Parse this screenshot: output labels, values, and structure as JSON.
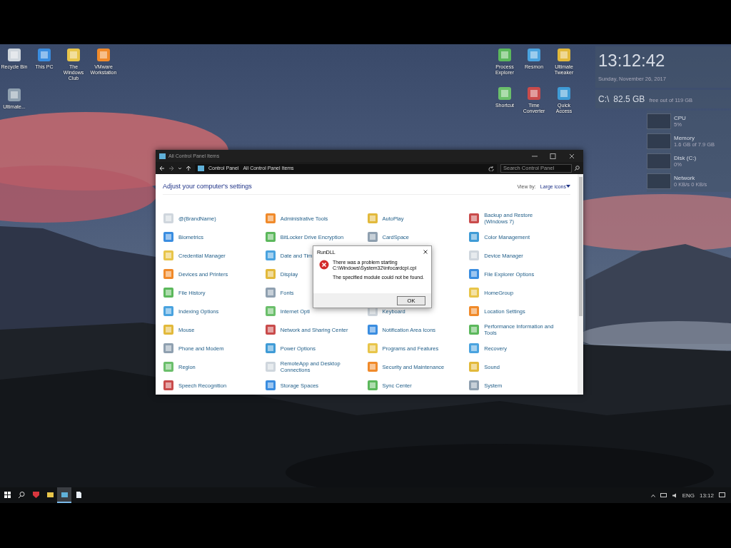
{
  "desktop_icons": [
    {
      "label": "Recycle Bin"
    },
    {
      "label": "This PC"
    },
    {
      "label": "The Windows Club"
    },
    {
      "label": "VMware Workstation"
    },
    {
      "label": "Process Explorer"
    },
    {
      "label": "Resmon"
    },
    {
      "label": "Ultimate Tweaker"
    },
    {
      "label": "Ultimate..."
    },
    {
      "label": "Shortcut"
    },
    {
      "label": "Time Converter"
    },
    {
      "label": "Quick Access"
    }
  ],
  "widgets": {
    "clock": {
      "time": "13:12:42",
      "date": "Sunday, November 26, 2017"
    },
    "disk": {
      "drive": "C:\\",
      "free": "82.5 GB",
      "detail": "free out of 119 GB"
    },
    "meters": [
      {
        "name": "CPU",
        "value": "5%"
      },
      {
        "name": "Memory",
        "value": "1.6 GB of 7.9 GB"
      },
      {
        "name": "Disk (C:)",
        "value": "0%"
      },
      {
        "name": "Network",
        "value": "0 KB/s 0 KB/s"
      }
    ]
  },
  "window": {
    "title": "All Control Panel Items",
    "breadcrumbs": [
      "Control Panel",
      "All Control Panel Items"
    ],
    "search": {
      "placeholder": "Search Control Panel"
    },
    "heading": "Adjust your computer's settings",
    "view_by": {
      "label": "View by:",
      "value": "Large icons"
    },
    "items": [
      {
        "kind": "item",
        "label": "@(BrandName)"
      },
      {
        "kind": "item",
        "label": "Administrative Tools"
      },
      {
        "kind": "item",
        "label": "AutoPlay"
      },
      {
        "kind": "item",
        "label": "Backup and Restore (Windows 7)"
      },
      {
        "kind": "item",
        "label": "Biometrics"
      },
      {
        "kind": "item",
        "label": "BitLocker Drive Encryption"
      },
      {
        "kind": "item",
        "label": "CardSpace"
      },
      {
        "kind": "item",
        "label": "Color Management"
      },
      {
        "kind": "item",
        "label": "Credential Manager"
      },
      {
        "kind": "item",
        "label": "Date and Tim"
      },
      {
        "kind": "covered"
      },
      {
        "kind": "item",
        "label": "Device Manager"
      },
      {
        "kind": "item",
        "label": "Devices and Printers"
      },
      {
        "kind": "item",
        "label": "Display"
      },
      {
        "kind": "covered"
      },
      {
        "kind": "item",
        "label": "File Explorer Options"
      },
      {
        "kind": "item",
        "label": "File History"
      },
      {
        "kind": "item",
        "label": "Fonts"
      },
      {
        "kind": "covered"
      },
      {
        "kind": "item",
        "label": "HomeGroup"
      },
      {
        "kind": "item",
        "label": "Indexing Options"
      },
      {
        "kind": "item",
        "label": "Internet Opti"
      },
      {
        "kind": "item",
        "label": "Keyboard"
      },
      {
        "kind": "item",
        "label": "Location Settings"
      },
      {
        "kind": "item",
        "label": "Mouse"
      },
      {
        "kind": "item",
        "label": "Network and Sharing Center"
      },
      {
        "kind": "item",
        "label": "Notification Area Icons"
      },
      {
        "kind": "item",
        "label": "Performance Information and Tools"
      },
      {
        "kind": "item",
        "label": "Phone and Modem"
      },
      {
        "kind": "item",
        "label": "Power Options"
      },
      {
        "kind": "item",
        "label": "Programs and Features"
      },
      {
        "kind": "item",
        "label": "Recovery"
      },
      {
        "kind": "item",
        "label": "Region"
      },
      {
        "kind": "item",
        "label": "RemoteApp and Desktop Connections"
      },
      {
        "kind": "item",
        "label": "Security and Maintenance"
      },
      {
        "kind": "item",
        "label": "Sound"
      },
      {
        "kind": "item",
        "label": "Speech Recognition"
      },
      {
        "kind": "item",
        "label": "Storage Spaces"
      },
      {
        "kind": "item",
        "label": "Sync Center"
      },
      {
        "kind": "item",
        "label": "System"
      }
    ]
  },
  "dialog": {
    "title": "RunDLL",
    "message": "There was a problem starting",
    "path": "C:\\Windows\\System32\\infocardcpl.cpl",
    "detail": "The specified module could not be found.",
    "button": "OK"
  },
  "taskbar": {
    "apps": [
      {
        "kind": "start",
        "selected": false
      },
      {
        "kind": "search",
        "selected": false
      },
      {
        "kind": "shield",
        "selected": false
      },
      {
        "kind": "folder",
        "selected": false
      },
      {
        "kind": "panel",
        "selected": true
      },
      {
        "kind": "document",
        "selected": false
      }
    ],
    "language": "ENG",
    "time": "13:12"
  }
}
